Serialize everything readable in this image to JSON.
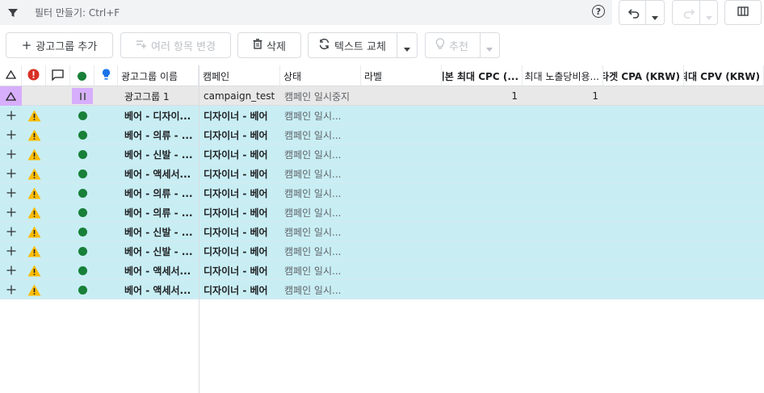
{
  "toolbar": {
    "filter_placeholder": "필터 만들기: Ctrl+F",
    "help_icon": "help-circle-icon",
    "undo_icon": "undo-icon",
    "redo_icon": "redo-icon",
    "columns_icon": "columns-icon"
  },
  "actions": {
    "add_group": "광고그룹 추가",
    "edit_multiple": "여러 항목 변경",
    "delete": "삭제",
    "replace_text": "텍스트 교체",
    "recommend": "추천"
  },
  "table": {
    "headers": {
      "adgroup_name": "광고그룹 이름",
      "campaign": "캠페인",
      "status": "상태",
      "label": "라벨",
      "max_cpc": "기본 최대 CPC (...",
      "max_cpm": "최대 노출당비용...",
      "target_cpa": "타겟 CPA (KRW)",
      "max_cpv": "최대 CPV (KRW)"
    },
    "header_icons": [
      "sort-triangle-icon",
      "error-icon",
      "comment-icon",
      "status-dot-icon",
      "suggestion-bulb-icon"
    ],
    "selected_row": {
      "name": "광고그룹 1",
      "campaign": "campaign_test",
      "status": "캠페인 일시중지",
      "max_cpc": "1",
      "max_cpm": "1"
    },
    "rows": [
      {
        "name": "베어 - 디자이...",
        "campaign": "디자이너 - 베어",
        "status": "캠페인 일시..."
      },
      {
        "name": "베어 - 의류 - ...",
        "campaign": "디자이너 - 베어",
        "status": "캠페인 일시..."
      },
      {
        "name": "베어 - 신발 - ...",
        "campaign": "디자이너 - 베어",
        "status": "캠페인 일시..."
      },
      {
        "name": "베어 - 액세서...",
        "campaign": "디자이너 - 베어",
        "status": "캠페인 일시..."
      },
      {
        "name": "베어 - 의류 - ...",
        "campaign": "디자이너 - 베어",
        "status": "캠페인 일시..."
      },
      {
        "name": "베어 - 의류 - ...",
        "campaign": "디자이너 - 베어",
        "status": "캠페인 일시..."
      },
      {
        "name": "베어 - 신발 - ...",
        "campaign": "디자이너 - 베어",
        "status": "캠페인 일시..."
      },
      {
        "name": "베어 - 신발 - ...",
        "campaign": "디자이너 - 베어",
        "status": "캠페인 일시..."
      },
      {
        "name": "베어 - 액세서...",
        "campaign": "디자이너 - 베어",
        "status": "캠페인 일시..."
      },
      {
        "name": "베어 - 액세서...",
        "campaign": "디자이너 - 베어",
        "status": "캠페인 일시..."
      }
    ]
  },
  "colors": {
    "new_row_bg": "#c8eef4",
    "selected_row_bg": "#e8e8e8",
    "accent_purple": "#d7aefb",
    "warning": "#fbbc04",
    "enabled_green": "#188038",
    "error_red": "#d93025",
    "bulb_blue": "#1a73e8"
  }
}
